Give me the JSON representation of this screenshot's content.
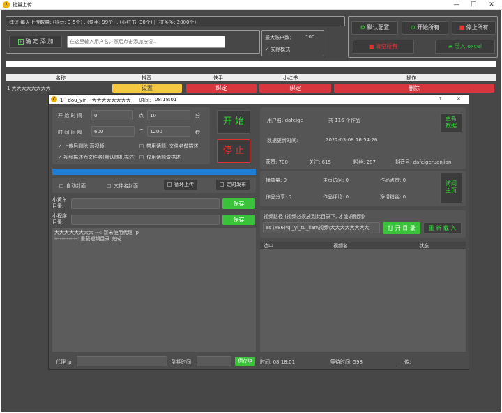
{
  "window": {
    "title": "批量上传",
    "app_icon": "ℓ"
  },
  "top": {
    "hint": "建议 每天上传数量: (抖音: 3-5个) , (快手: 99个) , (小红书: 30个) | (拼多多: 2000个)",
    "add_button": "确 定 添 加",
    "user_input_placeholder": "在这里输入用户名，然后点击添加按钮...",
    "max_accounts_label": "最大账户数：",
    "max_accounts_value": "100",
    "safe_mode_label": "安静模式",
    "default_config": "默认配置",
    "start_all": "开始所有",
    "stop_all": "停止所有",
    "delete_all": "清空所有",
    "import": "导入 excel"
  },
  "table": {
    "headers": [
      "名称",
      "抖音",
      "快手",
      "小红书",
      "操作"
    ],
    "row": {
      "name": "1 大大大大大大大大",
      "douyin": "设置",
      "kuaishou": "绑定",
      "xiaohongshu": "绑定",
      "action": "删除"
    }
  },
  "dialog": {
    "title": "1 - dou_yin - 大大大大大大大大",
    "time_label": "时间:",
    "time_value": "08:18:01",
    "help": "?",
    "close": "✕",
    "start_time_label": "开 始 时 间",
    "start_hour": "0",
    "hour_unit": "点",
    "start_minute": "10",
    "minute_unit": "分",
    "interval_label": "时 间 间 隔",
    "interval_min": "600",
    "interval_sep": "~",
    "interval_max": "1200",
    "second_unit": "秒",
    "opt_delete_after": "上传后删除 源视频",
    "opt_ban_topic": "禁用话题, 文件名做描述",
    "opt_desc_filename": "视频描述为文件名(默认随机描述)",
    "opt_topic_only": "仅用话题做描述",
    "start_btn": "开 始",
    "stop_btn": "停 止",
    "auto_cover": "自动封面",
    "filename_cover": "文件名封面",
    "loop_upload": "循环上传",
    "timed_publish": "定时发布",
    "cart_label": "小黄车\n目录:",
    "cart_save": "保存",
    "mini_label": "小程序\n目录:",
    "mini_save": "保存",
    "log_lines": [
      "大大大大大大大大 ---: 暂未使用代理 ip",
      "-------------: 重载视频目录 完成"
    ],
    "proxy_label": "代理 ip",
    "expire_label": "到期时间",
    "save_ip": "保存ip",
    "status_time": "时间: 08:18:01",
    "wait_time": "等待时间: 598",
    "upload_label": "上传:",
    "username_label": "用户名: dafeige",
    "works_count": "共 116 个作品",
    "refresh_btn": "更新\n数据",
    "update_label": "数据更新时间:",
    "update_time": "2022-03-08 16:54:26",
    "likes": "获赞: 700",
    "follow": "关注: 615",
    "fans": "粉丝: 287",
    "dy_id": "抖音号: dafeigeruanjian",
    "plays": "播放量: 0",
    "home_visits": "主页访问: 0",
    "work_likes": "作品点赞: 0",
    "shares": "作品分享: 0",
    "comments": "作品评论: 0",
    "net_fans": "净增粉丝: 0",
    "visit_home": "访问\n主页",
    "path_label": "视频路径 (视频必须放到此目录下, 才能识别到)",
    "path_value": "es (x86)\\qi_yi_tu_lian\\视频\\大大大大大大大大",
    "open_dir": "打 开 目 录",
    "reload": "重 新 载 入",
    "list_headers": [
      "选中",
      "视频名",
      "状态"
    ]
  },
  "colors": {
    "accent_green": "#3ac23a",
    "accent_red": "#d8363f",
    "accent_yellow": "#f5c842",
    "progress_blue": "#1e7ed6"
  }
}
